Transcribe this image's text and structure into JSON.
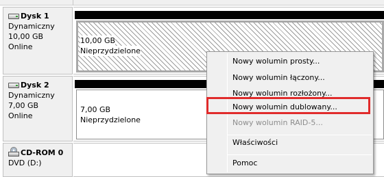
{
  "disks": [
    {
      "name": "Dysk 1",
      "type": "Dynamiczny",
      "size": "10,00 GB",
      "status": "Online",
      "volume": {
        "size": "10,00 GB",
        "state": "Nieprzydzielone"
      }
    },
    {
      "name": "Dysk 2",
      "type": "Dynamiczny",
      "size": "7,00 GB",
      "status": "Online",
      "volume": {
        "size": "7,00 GB",
        "state": "Nieprzydzielone"
      }
    },
    {
      "name": "CD-ROM 0",
      "drive": "DVD (D:)"
    }
  ],
  "context_menu": {
    "items": [
      {
        "label": "Nowy wolumin prosty...",
        "enabled": true
      },
      {
        "label": "Nowy wolumin łączony...",
        "enabled": true
      },
      {
        "label": "Nowy wolumin rozłożony...",
        "enabled": true
      },
      {
        "label": "Nowy wolumin dublowany...",
        "enabled": true,
        "highlighted": true
      },
      {
        "label": "Nowy wolumin RAID-5...",
        "enabled": false
      },
      {
        "label": "Właściwości",
        "enabled": true
      },
      {
        "label": "Pomoc",
        "enabled": true
      }
    ]
  },
  "colors": {
    "highlight_border": "#e02b2b",
    "menu_background": "#f0f0f0",
    "volume_header_bar": "#000000",
    "disabled_text": "#8d8d8d"
  },
  "icons": {
    "disk": "hard-disk-icon",
    "cdrom": "cdrom-drive-icon"
  }
}
